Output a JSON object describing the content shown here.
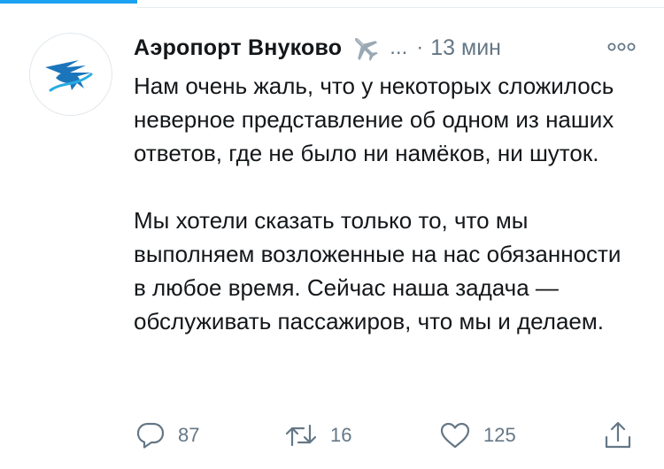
{
  "tweet": {
    "author_name": "Аэропорт Внуково",
    "handle": "...",
    "separator": "·",
    "time": "13 мин",
    "paragraphs": [
      "Нам очень жаль, что у некоторых сложилось неверное представление об одном из наших ответов, где не было ни намёков, ни шуток.",
      "Мы хотели сказать только то, что мы выполняем возложенные на нас обязанности в любое время. Сейчас наша задача — обслуживать пассажиров, что мы и делаем."
    ],
    "actions": {
      "reply_count": "87",
      "retweet_count": "16",
      "like_count": "125"
    }
  },
  "icons": {
    "avatar": "vnukovo-logo-icon",
    "author_badge": "airplane-icon",
    "more": "more-icon",
    "reply": "reply-icon",
    "retweet": "retweet-icon",
    "like": "heart-icon",
    "share": "share-icon"
  },
  "colors": {
    "accent": "#1da1f2",
    "text": "#14171a",
    "secondary": "#657786",
    "logo_blue": "#1b75bb"
  }
}
